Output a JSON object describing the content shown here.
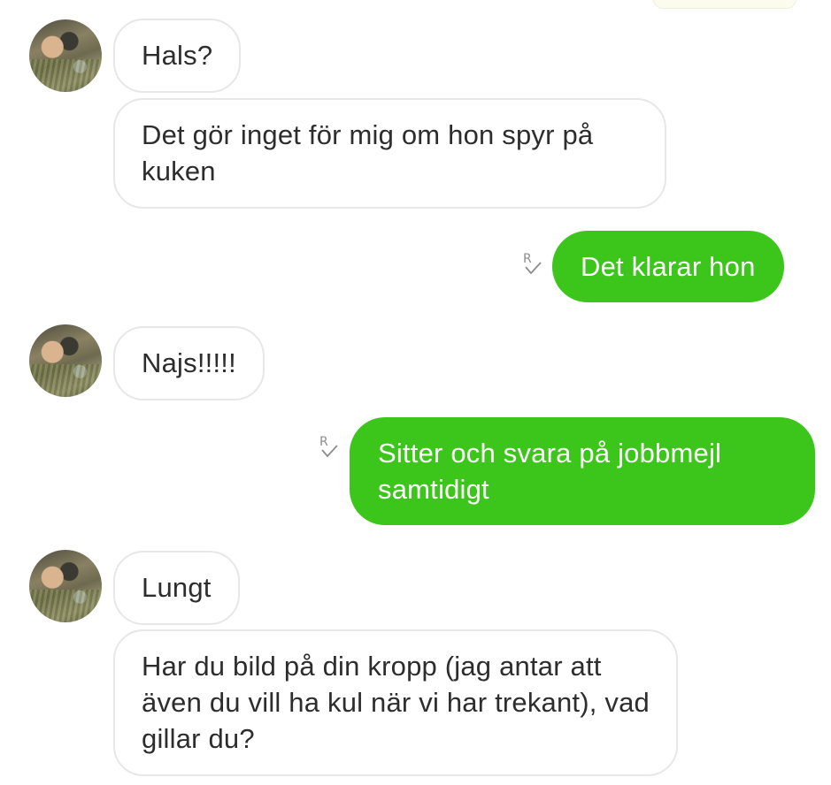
{
  "messages": [
    {
      "direction": "incoming",
      "text": "Hals?"
    },
    {
      "direction": "incoming",
      "text": "Det gör inget för mig om hon spyr på kuken"
    },
    {
      "direction": "outgoing",
      "text": "Det klarar hon",
      "receipt_icon": "read-receipt-icon"
    },
    {
      "direction": "incoming",
      "text": "Najs!!!!!"
    },
    {
      "direction": "outgoing",
      "text": "Sitter och svara på jobbmejl samtidigt",
      "receipt_icon": "read-receipt-icon"
    },
    {
      "direction": "incoming",
      "text": "Lungt"
    },
    {
      "direction": "incoming",
      "text": "Har du bild på din kropp (jag antar att även du vill ha kul när vi har trekant), vad gillar du?"
    }
  ],
  "colors": {
    "outgoing_bubble": "#3cc51a",
    "incoming_bubble": "#ffffff",
    "incoming_border": "#e7e7e7",
    "receipt": "#8d8d8d"
  }
}
